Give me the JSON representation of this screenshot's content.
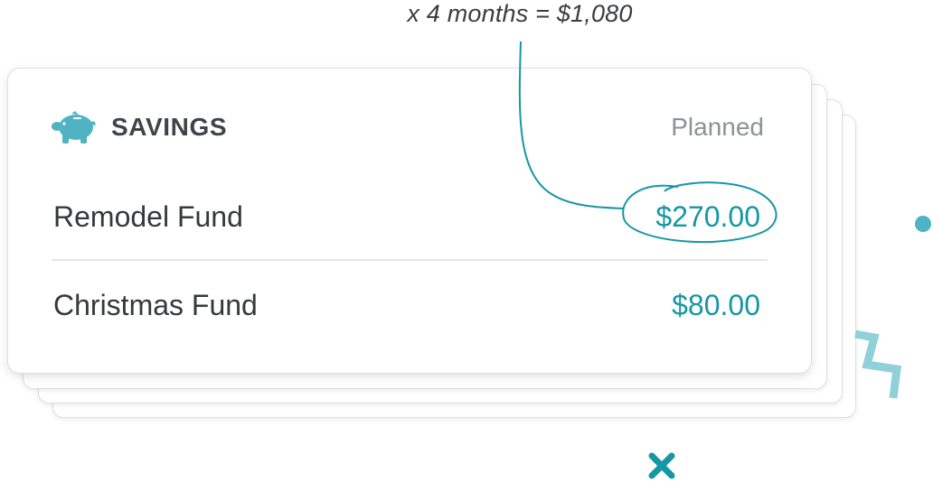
{
  "annotation": {
    "text": "x 4 months = $1,080"
  },
  "card": {
    "title": "SAVINGS",
    "icon": "piggy-bank-icon",
    "column_header": "Planned",
    "rows": [
      {
        "label": "Remodel Fund",
        "amount": "$270.00",
        "highlighted": true
      },
      {
        "label": "Christmas Fund",
        "amount": "$80.00",
        "highlighted": false
      }
    ]
  },
  "decorations": {
    "dot": "dot-icon",
    "zigzag": "zigzag-icon",
    "cross": "close-icon"
  },
  "colors": {
    "accent": "#1597a4",
    "icon": "#4fb3c3",
    "text": "#35383d",
    "muted": "#8c9196"
  }
}
